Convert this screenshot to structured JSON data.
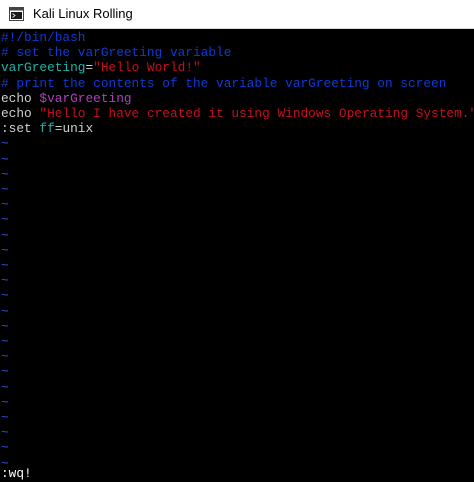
{
  "window": {
    "title": "Kali Linux Rolling"
  },
  "editor": {
    "lines": [
      {
        "segments": [
          {
            "text": "#!/bin/bash",
            "style": "comment"
          }
        ]
      },
      {
        "segments": [
          {
            "text": "# set the varGreeting variable",
            "style": "comment"
          }
        ]
      },
      {
        "segments": [
          {
            "text": "varGreeting",
            "style": "ident"
          },
          {
            "text": "=",
            "style": "plain"
          },
          {
            "text": "\"Hello World!\"",
            "style": "string"
          }
        ]
      },
      {
        "segments": [
          {
            "text": "# print the contents of the variable varGreeting on screen",
            "style": "comment"
          }
        ]
      },
      {
        "segments": [
          {
            "text": "echo ",
            "style": "plain"
          },
          {
            "text": "$varGreeting",
            "style": "var"
          }
        ]
      },
      {
        "segments": [
          {
            "text": "echo ",
            "style": "plain"
          },
          {
            "text": "\"Hello I have created it using Windows Operating System.\"",
            "style": "string"
          }
        ]
      },
      {
        "segments": [
          {
            "text": ":set ",
            "style": "plain"
          },
          {
            "text": "ff",
            "style": "ident"
          },
          {
            "text": "=unix",
            "style": "plain"
          }
        ]
      }
    ],
    "empty_line_marker": "~",
    "empty_line_count": 22,
    "command_line": ":wq!"
  },
  "colors": {
    "background": "#000000",
    "comment": "#0f3ad6",
    "identifier": "#1fb3a8",
    "string": "#c50f1f",
    "variable": "#b03fbf",
    "tilde": "#2f4fe0"
  },
  "icons": {
    "app": "terminal-app-icon"
  }
}
